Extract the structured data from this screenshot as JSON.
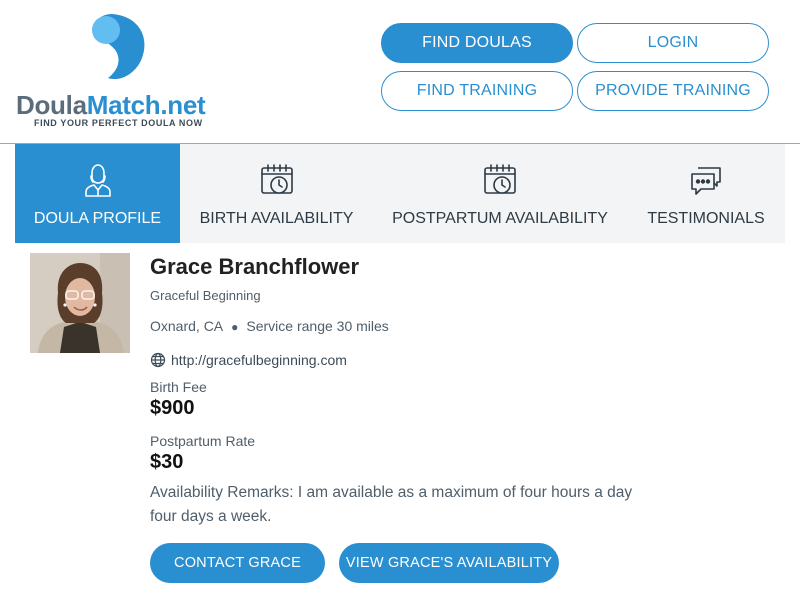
{
  "brand": {
    "name_part1": "Doula",
    "name_part2": "Match.net",
    "tagline": "FIND YOUR PERFECT DOULA NOW",
    "colors": {
      "primary": "#2a8fd0",
      "light": "#62bdf0",
      "gray": "#5b6c7a"
    }
  },
  "nav": {
    "find_doulas": "FIND DOULAS",
    "login": "LOGIN",
    "find_training": "FIND TRAINING",
    "provide_training": "PROVIDE TRAINING"
  },
  "tabs": [
    {
      "label": "DOULA PROFILE",
      "icon": "person-icon",
      "active": true
    },
    {
      "label": "BIRTH AVAILABILITY",
      "icon": "calendar-clock-icon",
      "active": false
    },
    {
      "label": "POSTPARTUM AVAILABILITY",
      "icon": "calendar-clock-icon",
      "active": false
    },
    {
      "label": "TESTIMONIALS",
      "icon": "chat-bubbles-icon",
      "active": false
    }
  ],
  "profile": {
    "name": "Grace Branchflower",
    "business": "Graceful Beginning",
    "location": "Oxnard, CA",
    "service_range": "Service range 30 miles",
    "website": "http://gracefulbeginning.com",
    "birth_fee_label": "Birth Fee",
    "birth_fee": "$900",
    "postpartum_label": "Postpartum Rate",
    "postpartum_rate": "$30",
    "remarks": "Availability Remarks: I am available as a maximum of four hours a day four days a week."
  },
  "actions": {
    "contact": "CONTACT GRACE",
    "availability": "VIEW GRACE'S AVAILABILITY"
  }
}
